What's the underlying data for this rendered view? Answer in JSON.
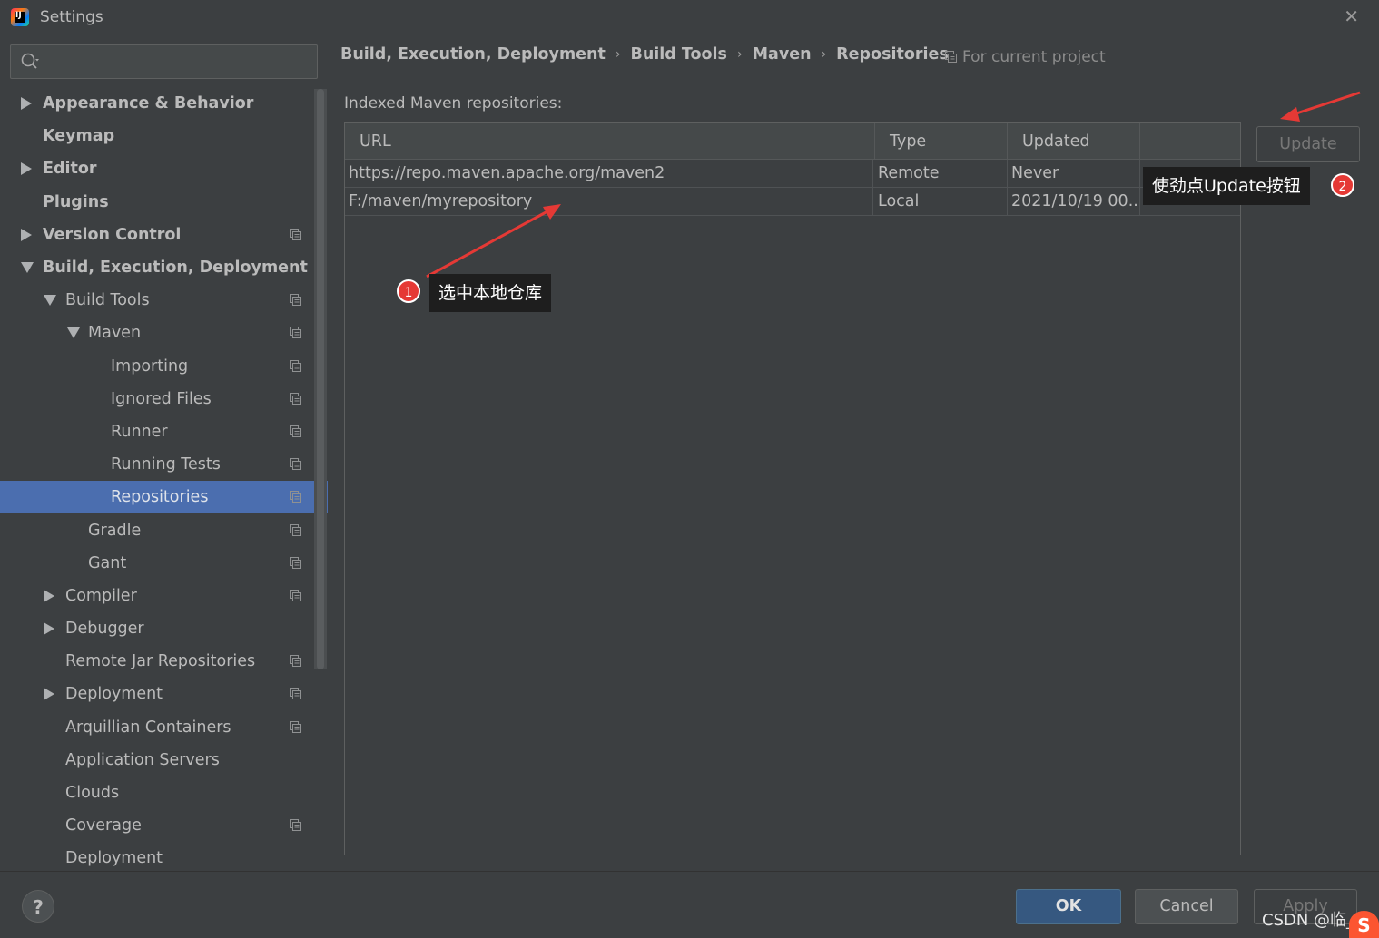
{
  "window": {
    "title": "Settings",
    "app_icon": "intellij-idea-icon",
    "close": "✕"
  },
  "sidebar": {
    "search": {
      "value": "",
      "placeholder": ""
    },
    "items": [
      {
        "label": "Appearance & Behavior",
        "bold": true,
        "arrow": "right",
        "indent": 0,
        "project_icon": false
      },
      {
        "label": "Keymap",
        "bold": true,
        "arrow": "none",
        "indent": 0,
        "project_icon": false
      },
      {
        "label": "Editor",
        "bold": true,
        "arrow": "right",
        "indent": 0,
        "project_icon": false
      },
      {
        "label": "Plugins",
        "bold": true,
        "arrow": "none",
        "indent": 0,
        "project_icon": false
      },
      {
        "label": "Version Control",
        "bold": true,
        "arrow": "right",
        "indent": 0,
        "project_icon": true
      },
      {
        "label": "Build, Execution, Deployment",
        "bold": true,
        "arrow": "down",
        "indent": 0,
        "project_icon": false
      },
      {
        "label": "Build Tools",
        "bold": false,
        "arrow": "down",
        "indent": 1,
        "project_icon": true
      },
      {
        "label": "Maven",
        "bold": false,
        "arrow": "down",
        "indent": 2,
        "project_icon": true
      },
      {
        "label": "Importing",
        "bold": false,
        "arrow": "none",
        "indent": 3,
        "project_icon": true
      },
      {
        "label": "Ignored Files",
        "bold": false,
        "arrow": "none",
        "indent": 3,
        "project_icon": true
      },
      {
        "label": "Runner",
        "bold": false,
        "arrow": "none",
        "indent": 3,
        "project_icon": true
      },
      {
        "label": "Running Tests",
        "bold": false,
        "arrow": "none",
        "indent": 3,
        "project_icon": true
      },
      {
        "label": "Repositories",
        "bold": false,
        "arrow": "none",
        "indent": 3,
        "project_icon": true,
        "selected": true
      },
      {
        "label": "Gradle",
        "bold": false,
        "arrow": "none",
        "indent": 2,
        "project_icon": true
      },
      {
        "label": "Gant",
        "bold": false,
        "arrow": "none",
        "indent": 2,
        "project_icon": true
      },
      {
        "label": "Compiler",
        "bold": false,
        "arrow": "right",
        "indent": 1,
        "project_icon": true
      },
      {
        "label": "Debugger",
        "bold": false,
        "arrow": "right",
        "indent": 1,
        "project_icon": false
      },
      {
        "label": "Remote Jar Repositories",
        "bold": false,
        "arrow": "none",
        "indent": 1,
        "project_icon": true
      },
      {
        "label": "Deployment",
        "bold": false,
        "arrow": "right",
        "indent": 1,
        "project_icon": true
      },
      {
        "label": "Arquillian Containers",
        "bold": false,
        "arrow": "none",
        "indent": 1,
        "project_icon": true
      },
      {
        "label": "Application Servers",
        "bold": false,
        "arrow": "none",
        "indent": 1,
        "project_icon": false
      },
      {
        "label": "Clouds",
        "bold": false,
        "arrow": "none",
        "indent": 1,
        "project_icon": false
      },
      {
        "label": "Coverage",
        "bold": false,
        "arrow": "none",
        "indent": 1,
        "project_icon": true
      },
      {
        "label": "Deployment",
        "bold": false,
        "arrow": "none",
        "indent": 1,
        "project_icon": false
      }
    ]
  },
  "breadcrumb": [
    "Build, Execution, Deployment",
    "Build Tools",
    "Maven",
    "Repositories"
  ],
  "breadcrumb_separator": "›",
  "for_current_project": "For current project",
  "section_label": "Indexed Maven repositories:",
  "table": {
    "columns": [
      "URL",
      "Type",
      "Updated"
    ],
    "rows": [
      [
        "https://repo.maven.apache.org/maven2",
        "Remote",
        "Never"
      ],
      [
        "F:/maven/myrepository",
        "Local",
        "2021/10/19 00..."
      ]
    ]
  },
  "buttons": {
    "update": "Update",
    "ok": "OK",
    "cancel": "Cancel",
    "apply": "Apply",
    "help": "?"
  },
  "annotations": [
    {
      "badge": "1",
      "text": "选中本地仓库"
    },
    {
      "badge": "2",
      "text": "使劲点Update按钮"
    }
  ],
  "watermark": "CSDN @临_7",
  "colors": {
    "background": "#3c3f41",
    "selection": "#4b6eaf",
    "ok_button": "#365880",
    "annotation_red": "#e53935",
    "tooltip_bg": "#1e1e1e"
  }
}
